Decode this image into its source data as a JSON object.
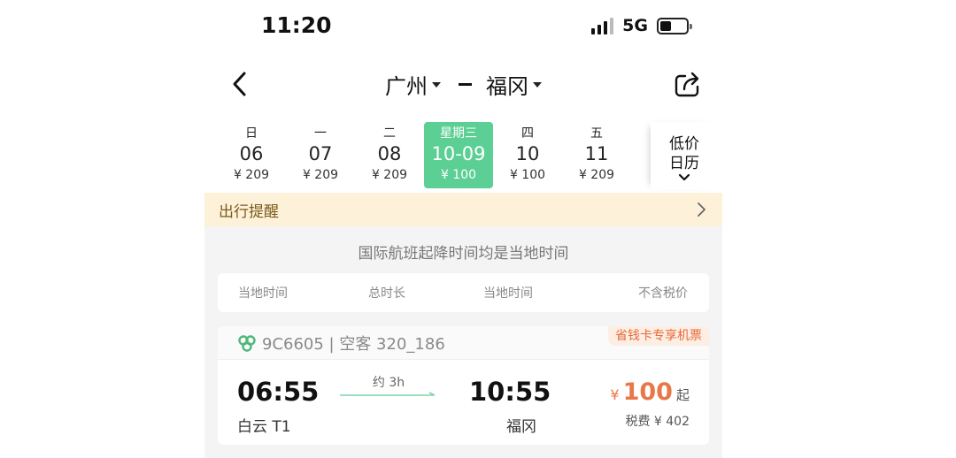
{
  "status_bar": {
    "time": "11:20",
    "network": "5G"
  },
  "nav": {
    "from_city": "广州",
    "to_city": "福冈"
  },
  "dates": [
    {
      "weekday": "日",
      "day": "06",
      "price": "¥ 209",
      "active": false
    },
    {
      "weekday": "一",
      "day": "07",
      "price": "¥ 209",
      "active": false
    },
    {
      "weekday": "二",
      "day": "08",
      "price": "¥ 209",
      "active": false
    },
    {
      "weekday": "星期三",
      "day": "10-09",
      "price": "¥ 100",
      "active": true
    },
    {
      "weekday": "四",
      "day": "10",
      "price": "¥ 100",
      "active": false
    },
    {
      "weekday": "五",
      "day": "11",
      "price": "¥ 209",
      "active": false
    }
  ],
  "calendar_button": {
    "line1": "低价",
    "line2": "日历"
  },
  "reminder": {
    "label": "出行提醒"
  },
  "note": "国际航班起降时间均是当地时间",
  "columns": [
    "当地时间",
    "总时长",
    "当地时间",
    "不含税价"
  ],
  "flight": {
    "code": "9C6605 | 空客 320_186",
    "promo": "省钱卡专享机票",
    "dep_time": "06:55",
    "dep_airport": "白云 T1",
    "duration": "约 3h",
    "arr_time": "10:55",
    "arr_airport": "福冈",
    "price_currency": "¥",
    "price_amount": "100",
    "price_suffix": "起",
    "tax": "税费 ¥ 402"
  },
  "colors": {
    "accent_green": "#5ccf94",
    "price_orange": "#e8774a",
    "reminder_bg": "#fdf1d9"
  }
}
